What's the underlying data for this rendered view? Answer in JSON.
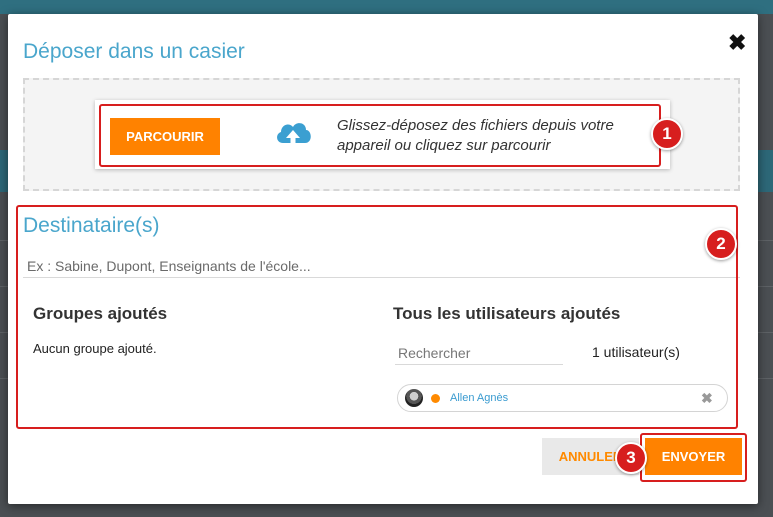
{
  "modal": {
    "title": "Déposer dans un casier",
    "close_icon": "close-icon"
  },
  "upload": {
    "browse_label": "PARCOURIR",
    "hint": "Glissez-déposez des fichiers depuis votre appareil ou cliquez sur parcourir",
    "icon": "cloud-upload-icon"
  },
  "recipients": {
    "title": "Destinataire(s)",
    "placeholder": "Ex : Sabine, Dupont, Enseignants de l'école...",
    "groups_title": "Groupes ajoutés",
    "groups_empty": "Aucun groupe ajouté.",
    "users_title": "Tous les utilisateurs ajoutés",
    "search_placeholder": "Rechercher",
    "users_count": "1 utilisateur(s)",
    "users": [
      {
        "name": "Allen Agnès",
        "status_color": "#ff8a00"
      }
    ]
  },
  "actions": {
    "cancel_label": "ANNULER",
    "send_label": "ENVOYER"
  },
  "callouts": [
    "1",
    "2",
    "3"
  ],
  "colors": {
    "accent": "#ff8200",
    "title": "#4aa6cc",
    "callout": "#d71e1e"
  }
}
